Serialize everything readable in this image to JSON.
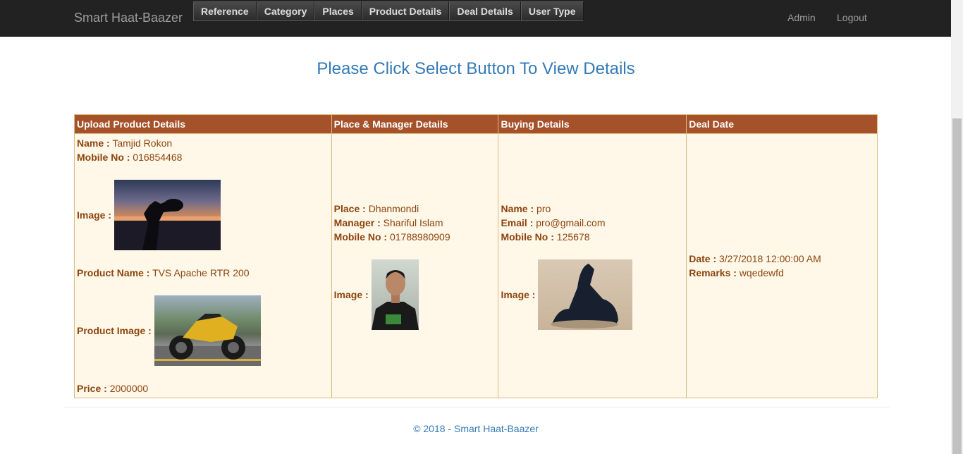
{
  "navbar": {
    "brand": "Smart Haat-Baazer",
    "menu": [
      "Reference",
      "Category",
      "Places",
      "Product Details",
      "Deal Details",
      "User Type"
    ],
    "admin": "Admin",
    "logout": "Logout"
  },
  "heading": "Please Click Select Button To View Details",
  "table": {
    "headers": [
      "Upload Product Details",
      "Place & Manager Details",
      "Buying Details",
      "Deal Date"
    ],
    "upload": {
      "name_label": "Name :",
      "name": "Tamjid Rokon",
      "mobile_label": "Mobile No :",
      "mobile": "016854468",
      "image_label": "Image :",
      "product_name_label": "Product Name :",
      "product_name": "TVS Apache RTR 200",
      "product_image_label": "Product Image :",
      "price_label": "Price :",
      "price": "2000000"
    },
    "place": {
      "place_label": "Place :",
      "place": "Dhanmondi",
      "manager_label": "Manager :",
      "manager": "Shariful Islam",
      "mobile_label": "Mobile No :",
      "mobile": "01788980909",
      "image_label": "Image :"
    },
    "buying": {
      "name_label": "Name :",
      "name": "pro",
      "email_label": "Email :",
      "email": "pro@gmail.com",
      "mobile_label": "Mobile No :",
      "mobile": "125678",
      "image_label": "Image :"
    },
    "deal": {
      "date_label": "Date :",
      "date": "3/27/2018 12:00:00 AM",
      "remarks_label": "Remarks :",
      "remarks": "wqedewfd"
    }
  },
  "footer": "© 2018 - Smart Haat-Baazer",
  "colors": {
    "navbar": "#222222",
    "header_row": "#a55129",
    "cell_bg": "#fff7e7",
    "text_brown": "#8c4510",
    "link_blue": "#337ab7"
  }
}
